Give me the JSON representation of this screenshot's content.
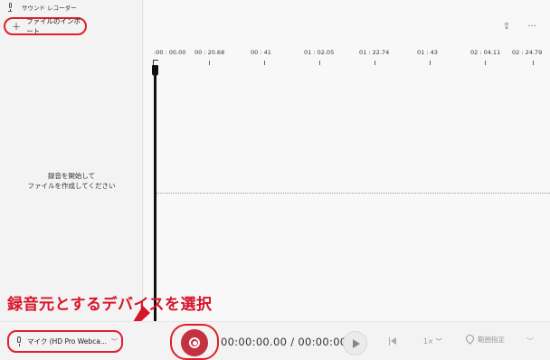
{
  "window": {
    "title": "サウンド レコーダー",
    "icon": "microphone-icon"
  },
  "sidebar": {
    "import_button": {
      "icon": "plus-icon",
      "label": "ファイルのインポート"
    },
    "empty_message": {
      "line1": "録音を開始して",
      "line2": "ファイルを作成してください"
    }
  },
  "toolbar": {
    "share_icon": "share-icon",
    "more_icon": "more-options-icon"
  },
  "timeline": {
    "labels": [
      ":00 : 00.00",
      "00 : 20.68",
      "00 : 41",
      "01 : 02.05",
      "01 : 22.74",
      "01 : 43",
      "02 : 04.11",
      "02 : 24.79"
    ]
  },
  "annotation": {
    "text": "録音元とするデバイスを選択",
    "color": "#d8142a"
  },
  "bottom_bar": {
    "device_button": {
      "icon": "microphone-icon",
      "label": "マイク (HD Pro Webca...",
      "chevron": "﹀"
    },
    "record_button": {
      "icon": "record-icon"
    },
    "time": {
      "current": "00:00:00.00",
      "separator": "/",
      "total": "00:00:00"
    },
    "play_button": {
      "icon": "play-icon"
    },
    "skip_back": {
      "icon": "skip-to-start-icon"
    },
    "speed": {
      "label": "1×",
      "chevron": "﹀"
    },
    "mark_button": {
      "icon": "location-pin-icon",
      "label": "範囲指定"
    },
    "more_chevron": "﹀"
  },
  "colors": {
    "accent": "#e0202a",
    "record": "#c4313f"
  }
}
